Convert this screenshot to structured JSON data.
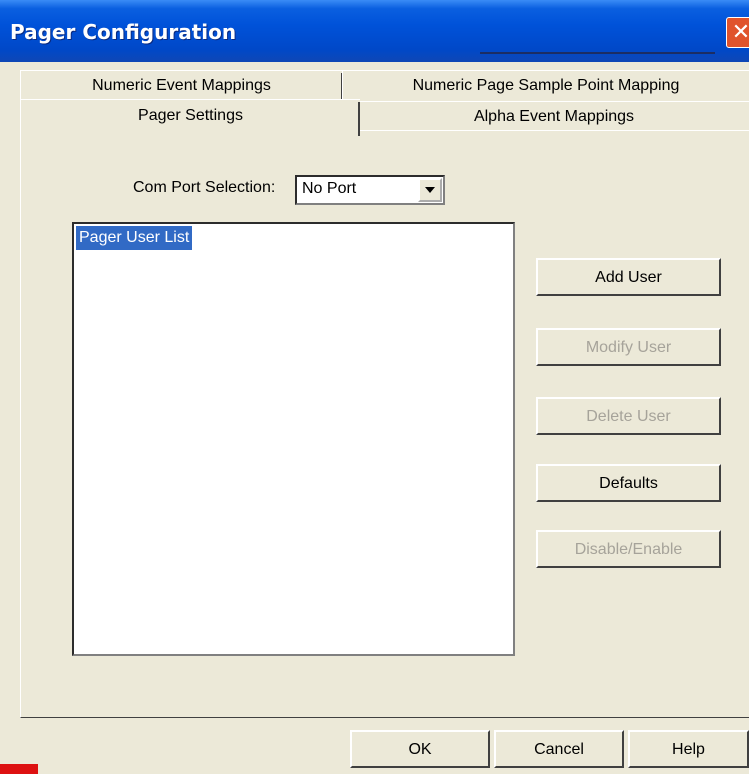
{
  "window": {
    "title": "Pager Configuration"
  },
  "tabs": {
    "row1": [
      {
        "label": "Numeric Event Mappings"
      },
      {
        "label": "Numeric Page Sample Point Mapping"
      }
    ],
    "row2": [
      {
        "label": "Pager Settings",
        "active": true
      },
      {
        "label": "Alpha Event Mappings"
      }
    ]
  },
  "com_port": {
    "label": "Com Port Selection:",
    "value": "No Port"
  },
  "user_list": {
    "items": [
      "Pager User List"
    ]
  },
  "actions": {
    "add": "Add User",
    "modify": "Modify User",
    "delete": "Delete User",
    "defaults": "Defaults",
    "toggle": "Disable/Enable"
  },
  "footer": {
    "ok": "OK",
    "cancel": "Cancel",
    "help": "Help"
  },
  "colors": {
    "title_bar": "#0052d9",
    "selection": "#316ac5",
    "dialog_bg": "#ece9d8",
    "close_button": "#e0532c"
  }
}
